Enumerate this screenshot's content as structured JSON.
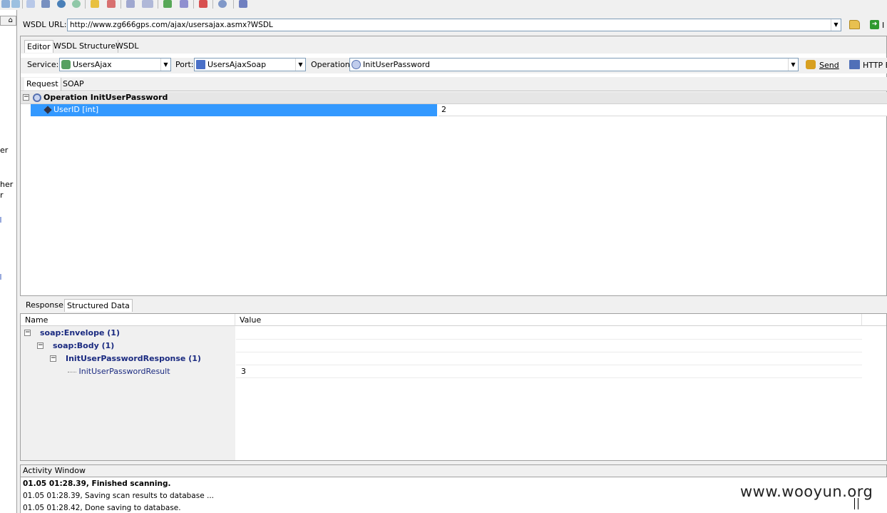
{
  "toolbar": {
    "icons": [
      "zoom-icon",
      "search-icon",
      "document-icon",
      "report-icon",
      "globe-icon",
      "gem-icon",
      "key-icon",
      "chart-icon",
      "tool-icon",
      "import-icon",
      "export-icon",
      "check-icon",
      "task-icon",
      "clock-icon",
      "table-icon"
    ]
  },
  "left_panel": {
    "pin_label": "\u0004",
    "fragments": [
      "er",
      "her",
      "r"
    ]
  },
  "wsdl": {
    "label": "WSDL URL:",
    "url": "http://www.zg666gps.com/ajax/usersajax.asmx?WSDL",
    "go_label": "I"
  },
  "editor": {
    "tabs": [
      "Editor",
      "WSDL Structure",
      "WSDL"
    ],
    "service_label": "Service:",
    "service_value": "UsersAjax",
    "port_label": "Port:",
    "port_value": "UsersAjaxSoap",
    "operation_label": "Operation:",
    "operation_value": "InitUserPassword",
    "send_label": "Send",
    "http_label": "HTTP E"
  },
  "request": {
    "tabs": [
      "Request",
      "SOAP"
    ],
    "operation_header": "Operation InitUserPassword",
    "param_name": "UserID [int]",
    "param_value": "2"
  },
  "response": {
    "tabs": [
      "Response",
      "Structured Data"
    ],
    "col_name": "Name",
    "col_value": "Value",
    "tree": [
      {
        "label": "soap:Envelope (1)",
        "value": ""
      },
      {
        "label": "soap:Body (1)",
        "value": ""
      },
      {
        "label": "InitUserPasswordResponse (1)",
        "value": ""
      },
      {
        "label": "InitUserPasswordResult",
        "value": "3"
      }
    ]
  },
  "activity": {
    "title": "Activity Window",
    "lines": [
      "01.05 01:28.39, Finished scanning.",
      "01.05 01:28.39, Saving scan results to database ...",
      "01.05 01:28.42, Done saving to database."
    ]
  },
  "watermark": "www.wooyun.org",
  "colors": {
    "selection": "#3399ff",
    "tree_text": "#1a2a80"
  }
}
